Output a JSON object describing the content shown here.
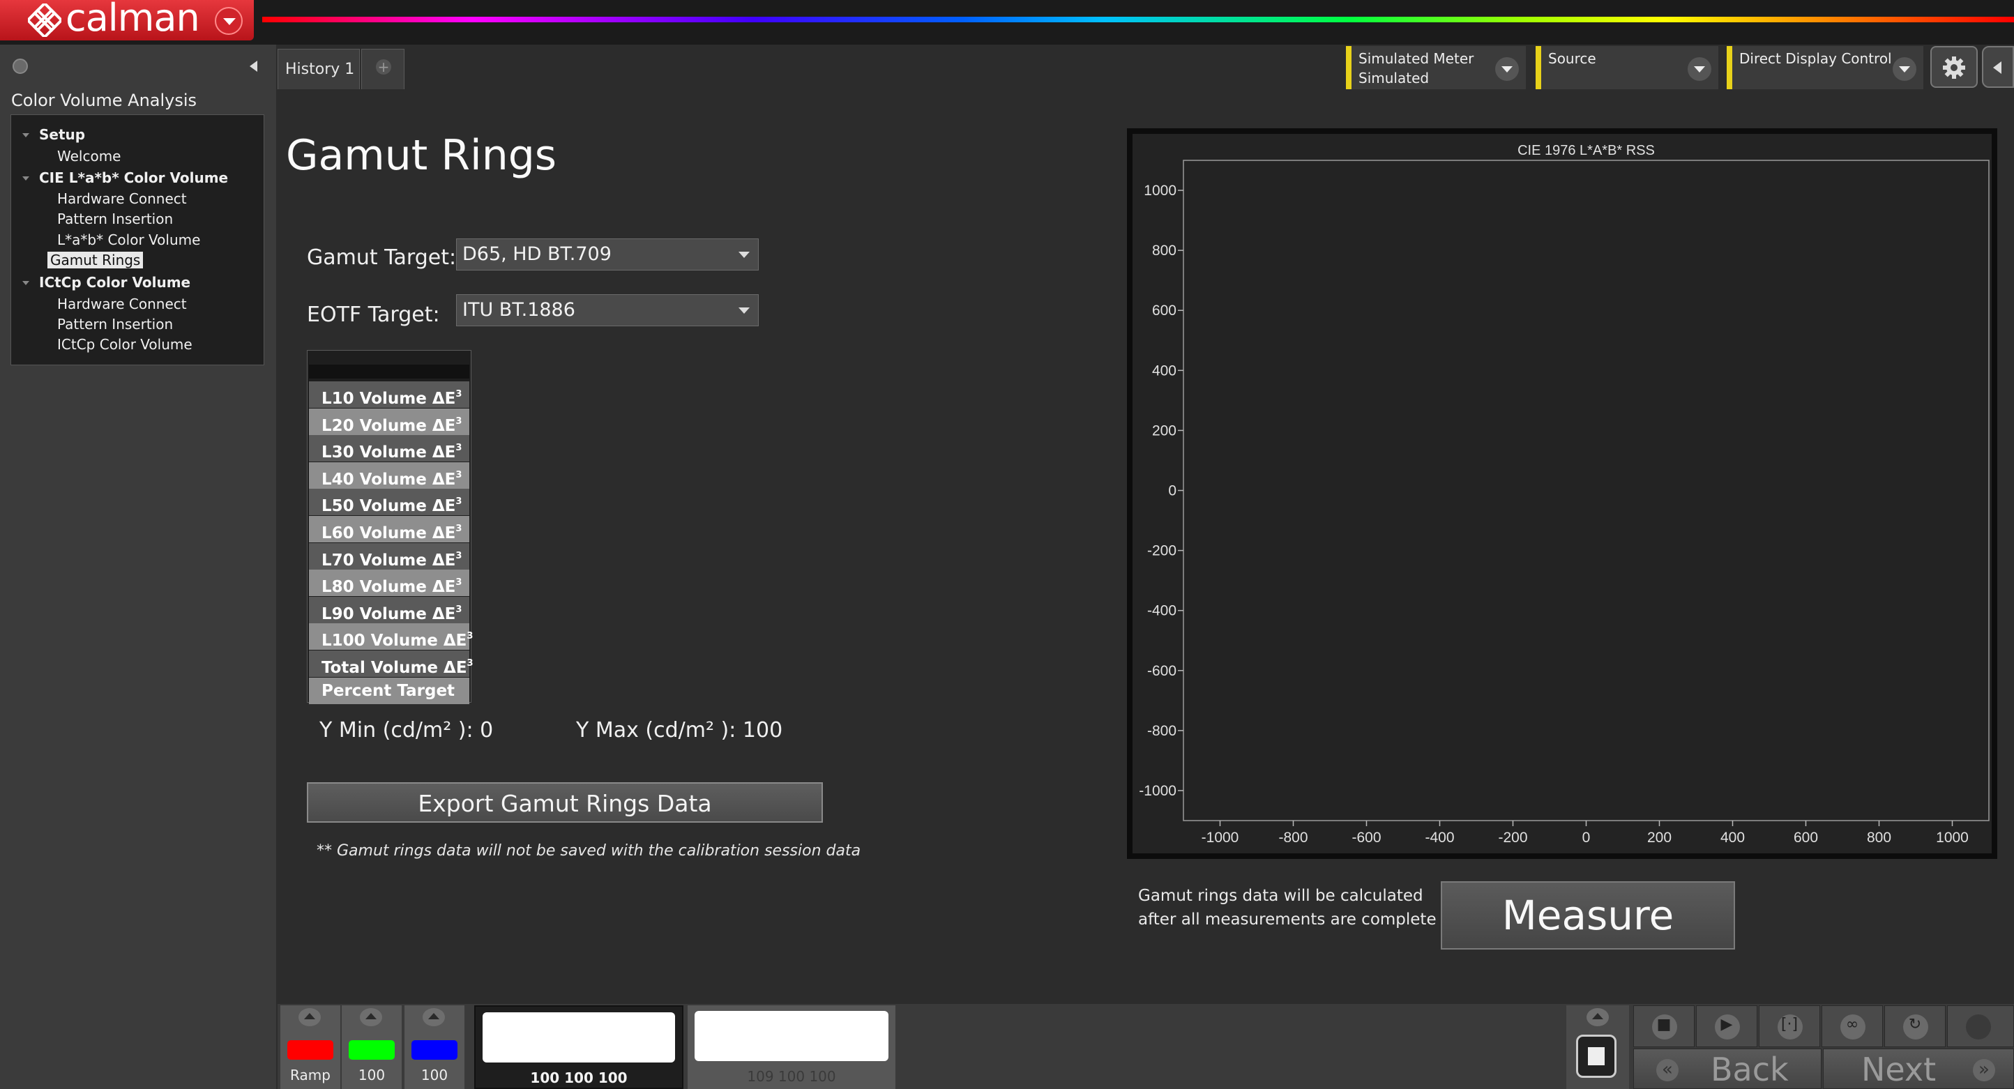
{
  "app": {
    "name": "calman"
  },
  "colors": {
    "brand_red": "#d0232a",
    "accent_yellow": "#e8d21a",
    "chart_bg": "#232323"
  },
  "sidebar": {
    "title": "Color Volume Analysis",
    "tree": [
      {
        "label": "Setup",
        "type": "group"
      },
      {
        "label": "Welcome",
        "type": "item"
      },
      {
        "label": "CIE L*a*b* Color Volume",
        "type": "group"
      },
      {
        "label": "Hardware Connect",
        "type": "item"
      },
      {
        "label": "Pattern Insertion",
        "type": "item"
      },
      {
        "label": "L*a*b* Color Volume",
        "type": "item"
      },
      {
        "label": "Gamut Rings",
        "type": "item",
        "selected": true
      },
      {
        "label": "ICtCp Color Volume",
        "type": "group"
      },
      {
        "label": "Hardware Connect",
        "type": "item"
      },
      {
        "label": "Pattern Insertion",
        "type": "item"
      },
      {
        "label": "ICtCp Color Volume",
        "type": "item"
      }
    ]
  },
  "tabs": {
    "history": "History 1"
  },
  "toolbar": {
    "meter": {
      "line1": "Simulated Meter",
      "line2": "Simulated"
    },
    "source": {
      "line1": "Source"
    },
    "display": {
      "line1": "Direct Display Control"
    }
  },
  "main": {
    "title": "Gamut Rings",
    "gamut_target_label": "Gamut Target:",
    "gamut_target_value": "D65, HD BT.709",
    "eotf_target_label": "EOTF Target:",
    "eotf_target_value": "ITU BT.1886",
    "volume_rows": [
      {
        "label": "L10 Volume ΔE",
        "sup": "3"
      },
      {
        "label": "L20 Volume ΔE",
        "sup": "3"
      },
      {
        "label": "L30 Volume ΔE",
        "sup": "3"
      },
      {
        "label": "L40 Volume ΔE",
        "sup": "3"
      },
      {
        "label": "L50 Volume ΔE",
        "sup": "3"
      },
      {
        "label": "L60 Volume ΔE",
        "sup": "3"
      },
      {
        "label": "L70 Volume ΔE",
        "sup": "3"
      },
      {
        "label": "L80 Volume ΔE",
        "sup": "3"
      },
      {
        "label": "L90 Volume ΔE",
        "sup": "3"
      },
      {
        "label": "L100 Volume ΔE",
        "sup": "3"
      },
      {
        "label": "Total Volume ΔE",
        "sup": "3"
      },
      {
        "label": "Percent Target",
        "sup": ""
      }
    ],
    "y_min": "Y Min (cd/m² ): 0",
    "y_max": "Y Max (cd/m² ): 100",
    "export_button": "Export Gamut Rings Data",
    "export_note": "** Gamut rings data will not be saved with the calibration session data",
    "measure_note": [
      "Gamut rings data will be calculated",
      "after all measurements are complete"
    ],
    "measure_button": "Measure"
  },
  "chart_data": {
    "type": "scatter",
    "title": "CIE 1976 L*A*B* RSS",
    "xlim": [
      -1100,
      1100
    ],
    "ylim": [
      -1100,
      1100
    ],
    "x_ticks": [
      -1000,
      -800,
      -600,
      -400,
      -200,
      0,
      200,
      400,
      600,
      800,
      1000
    ],
    "y_ticks": [
      1000,
      800,
      600,
      400,
      200,
      0,
      -200,
      -400,
      -600,
      -800,
      -1000
    ],
    "series": [],
    "grid": false
  },
  "bottom": {
    "swatches": [
      {
        "label": "Ramp",
        "color": "#ff0000"
      },
      {
        "label": "100",
        "color": "#00ff00"
      },
      {
        "label": "100",
        "color": "#0000ff"
      }
    ],
    "patterns": [
      {
        "label": "100 100 100"
      },
      {
        "label": "109 100 100"
      }
    ],
    "back": "Back",
    "next": "Next"
  }
}
